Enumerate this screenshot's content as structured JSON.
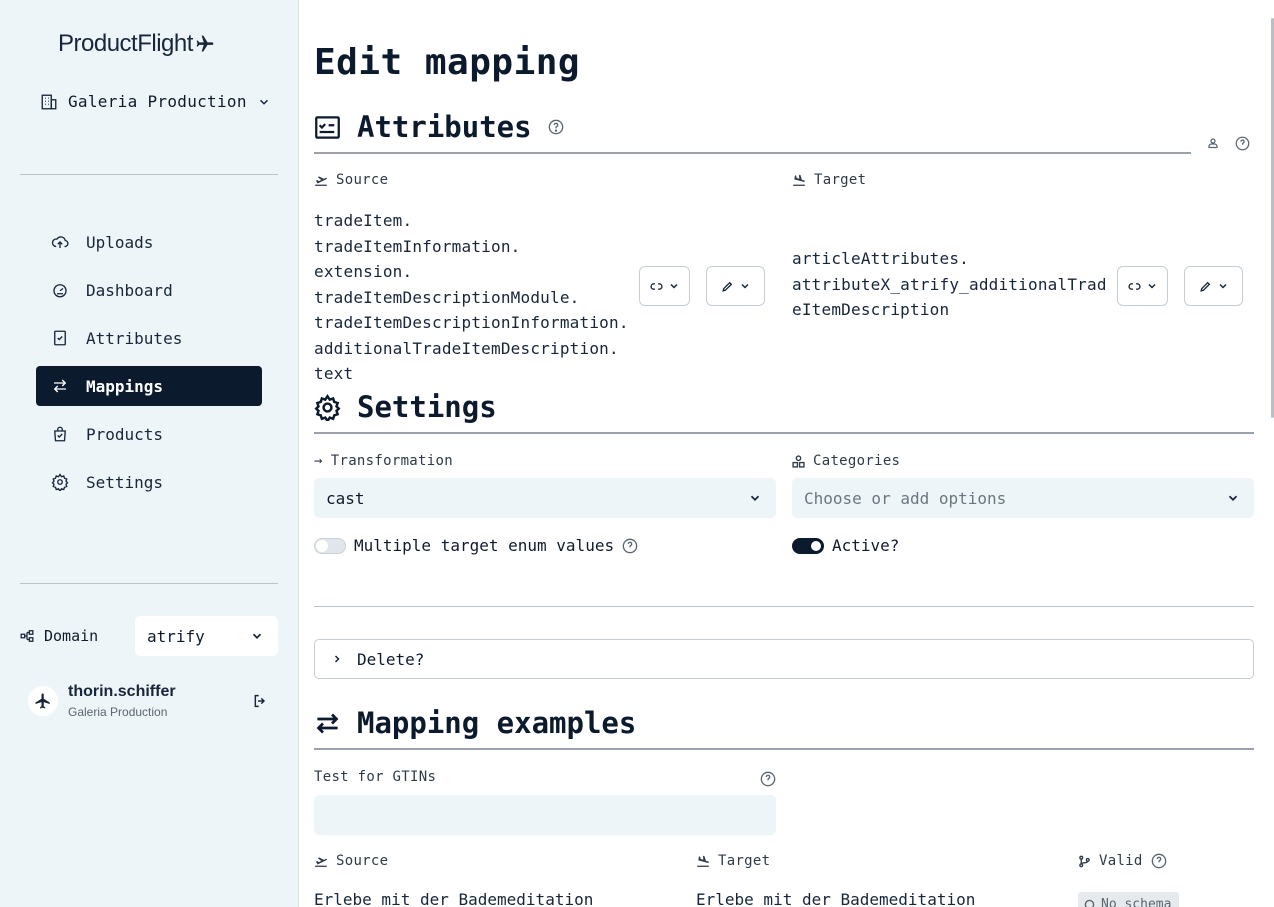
{
  "app": {
    "logo_text": "ProductFlight"
  },
  "org_selector": {
    "label": "Galeria Production"
  },
  "nav": {
    "items": [
      {
        "label": "Uploads",
        "icon": "upload-cloud-icon"
      },
      {
        "label": "Dashboard",
        "icon": "dashboard-icon"
      },
      {
        "label": "Attributes",
        "icon": "attributes-icon"
      },
      {
        "label": "Mappings",
        "icon": "mappings-icon",
        "active": true
      },
      {
        "label": "Products",
        "icon": "products-icon"
      },
      {
        "label": "Settings",
        "icon": "settings-icon"
      }
    ]
  },
  "domain": {
    "label": "Domain",
    "value": "atrify"
  },
  "user": {
    "name": "thorin.schiffer",
    "org": "Galeria Production"
  },
  "page": {
    "title": "Edit mapping"
  },
  "attributes": {
    "heading": "Attributes",
    "source_label": "Source",
    "target_label": "Target",
    "source_path": [
      "tradeItem. tradeItemInformation.",
      "extension.",
      "tradeItemDescriptionModule.",
      "tradeItemDescriptionInformation.",
      "additionalTradeItemDescription.",
      "text"
    ],
    "target_path": [
      "articleAttributes.",
      "attributeX_atrify_additionalTrad",
      "eItemDescription"
    ]
  },
  "settings": {
    "heading": "Settings",
    "transformation_label": "Transformation",
    "transformation_value": "cast",
    "categories_label": "Categories",
    "categories_placeholder": "Choose or add options",
    "multiple_enum_label": "Multiple target enum values",
    "multiple_enum_on": false,
    "active_label": "Active?",
    "active_on": true
  },
  "delete": {
    "label": "Delete?"
  },
  "examples": {
    "heading": "Mapping examples",
    "gtin_label": "Test for GTINs",
    "gtin_value": "",
    "source_label": "Source",
    "target_label": "Target",
    "valid_label": "Valid",
    "row": {
      "source": "Erlebe mit der Bademeditation",
      "target": "Erlebe mit der Bademeditation",
      "valid": "No schema"
    }
  },
  "colors": {
    "primary": "#0c1a2e",
    "sidebar_bg": "#eef5f9",
    "input_bg": "#eef5f9"
  }
}
